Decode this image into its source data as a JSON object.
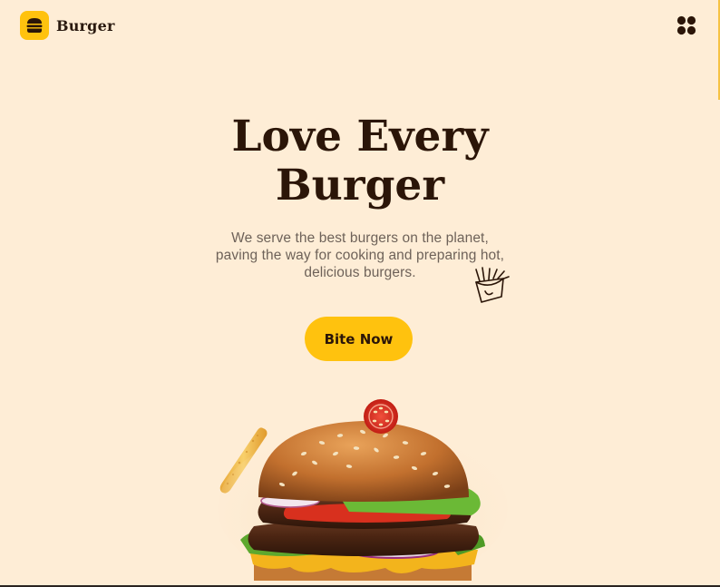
{
  "header": {
    "brand": "Burger",
    "logo_icon": "burger-icon",
    "menu_icon": "grid-menu-icon"
  },
  "hero": {
    "title_line1": "Love Every",
    "title_line2": "Burger",
    "subtitle_line1": "We serve the best burgers on the planet,",
    "subtitle_line2": "paving the way for cooking and preparing hot,",
    "subtitle_line3": "delicious burgers.",
    "cta_label": "Bite Now"
  },
  "colors": {
    "background": "#FEEDD6",
    "accent": "#FFC20E",
    "heading": "#2B1508",
    "body_text": "#6E6259"
  }
}
